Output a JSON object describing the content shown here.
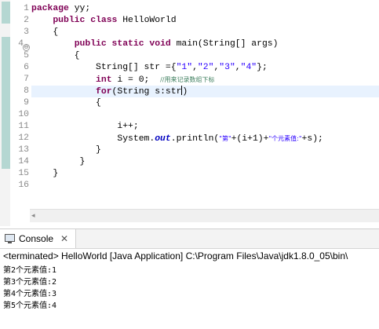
{
  "editor": {
    "line_numbers": [
      "1",
      "2",
      "3",
      "4",
      "5",
      "6",
      "7",
      "8",
      "9",
      "10",
      "11",
      "12",
      "13",
      "14",
      "15",
      "16"
    ],
    "lines": {
      "l1": {
        "kw_package": "package",
        "rest": " yy;"
      },
      "l2": {
        "indent": "    ",
        "kw_public": "public",
        "sp": " ",
        "kw_class": "class",
        "rest": " HelloWorld"
      },
      "l3": {
        "text": "    {"
      },
      "l4": {
        "indent": "        ",
        "kw_public": "public",
        "sp1": " ",
        "kw_static": "static",
        "sp2": " ",
        "kw_void": "void",
        "rest": " main(String[] args)"
      },
      "l5": {
        "text": "        {"
      },
      "l6": {
        "a": "            String[] str ={",
        "s1": "\"1\"",
        "c1": ",",
        "s2": "\"2\"",
        "c2": ",",
        "s3": "\"3\"",
        "c3": ",",
        "s4": "\"4\"",
        "end": "};"
      },
      "l7": {
        "indent": "            ",
        "kw_int": "int",
        "rest": " i = 0;  ",
        "comment": "//用来记录数组下标"
      },
      "l8": {
        "indent": "            ",
        "kw_for": "for",
        "rest": "(String s:str",
        "close": ")"
      },
      "l9": {
        "text": "            {"
      },
      "l10": {
        "text": ""
      },
      "l11": {
        "text": "                i++;"
      },
      "l12": {
        "a": "                System.",
        "field": "out",
        "b": ".println(",
        "s1": "\"第\"",
        "c": "+(i+1)+",
        "s2": "\"个元素值:\"",
        "d": "+s);"
      },
      "l13": {
        "text": "            }"
      },
      "l14": {
        "text": "         }"
      },
      "l15": {
        "text": "    }"
      },
      "l16": {
        "text": ""
      }
    }
  },
  "console": {
    "tab_label": "Console",
    "close_symbol": "✕",
    "status": "<terminated> HelloWorld [Java Application] C:\\Program Files\\Java\\jdk1.8.0_05\\bin\\",
    "output": [
      "第2个元素值:1",
      "第3个元素值:2",
      "第4个元素值:3",
      "第5个元素值:4"
    ]
  },
  "icons": {
    "fold": "⊖",
    "scroll_left": "◂"
  },
  "colors": {
    "keyword": "#7f0055",
    "string": "#2a00ff",
    "comment": "#3f7f5f",
    "field": "#0000c0",
    "current_line": "#e8f2fe",
    "change_marker": "#b5d7d2"
  }
}
